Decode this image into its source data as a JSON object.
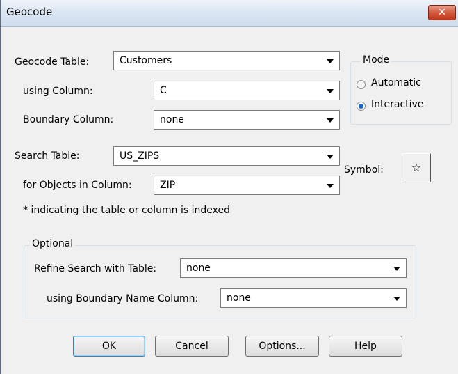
{
  "window": {
    "title": "Geocode",
    "close_glyph": "✕"
  },
  "geocode": {
    "table_label": "Geocode Table:",
    "table_value": "Customers",
    "column_label": "using Column:",
    "column_value": "C",
    "boundary_label": "Boundary Column:",
    "boundary_value": "none"
  },
  "mode": {
    "legend": "Mode",
    "options": [
      {
        "label": "Automatic",
        "selected": false
      },
      {
        "label": "Interactive",
        "selected": true
      }
    ]
  },
  "search": {
    "table_label": "Search Table:",
    "table_value": "US_ZIPS",
    "objects_label": "for Objects in Column:",
    "objects_value": "ZIP",
    "note": "* indicating the table or column is indexed"
  },
  "symbol": {
    "label": "Symbol:",
    "glyph": "☆"
  },
  "optional": {
    "legend": "Optional",
    "refine_label": "Refine Search with Table:",
    "refine_value": "none",
    "boundary_name_label": "using Boundary Name Column:",
    "boundary_name_value": "none"
  },
  "buttons": {
    "ok": "OK",
    "cancel": "Cancel",
    "options": "Options...",
    "help": "Help"
  },
  "colors": {
    "title_bar": "#dbe6f3",
    "close": "#c7432a",
    "radio_selected": "#1e64c8"
  }
}
